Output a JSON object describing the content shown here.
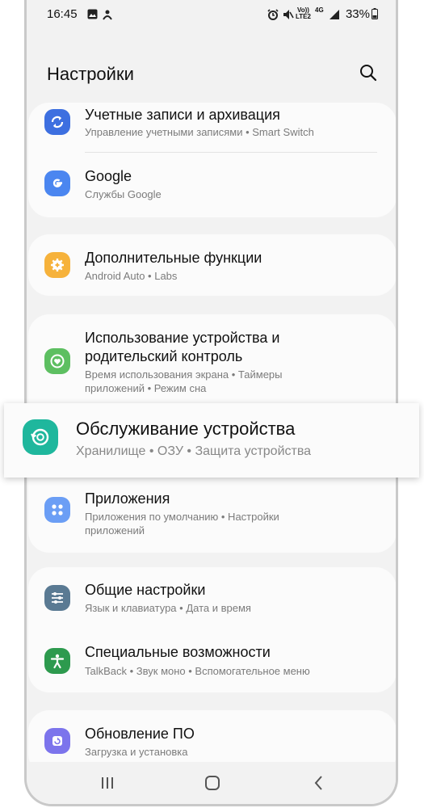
{
  "status": {
    "time": "16:45",
    "vol": "Vo))",
    "lte": "LTE2",
    "net": "4G",
    "battery": "33%"
  },
  "header": {
    "title": "Настройки"
  },
  "items": {
    "accounts": {
      "title": "Учетные записи и архивация",
      "subtitle": "Управление учетными записями • Smart Switch",
      "icon": "sync-icon",
      "color": "#3d6fe0"
    },
    "google": {
      "title": "Google",
      "subtitle": "Службы Google",
      "icon": "google-icon",
      "color": "#4b86f0"
    },
    "advanced": {
      "title": "Дополнительные функции",
      "subtitle": "Android Auto • Labs",
      "icon": "gear-plus-icon",
      "color": "#f6b23b"
    },
    "wellbeing": {
      "title_line1": "Использование устройства и",
      "title_line2": "родительский контроль",
      "subtitle_line1": "Время использования экрана • Таймеры",
      "subtitle_line2": "приложений • Режим сна",
      "icon": "heart-circle-icon",
      "color": "#5dbf61"
    },
    "care": {
      "title": "Обслуживание устройства",
      "subtitle": "Хранилище • ОЗУ • Защита устройства",
      "icon": "device-care-icon",
      "color": "#1fb79d"
    },
    "apps": {
      "title": "Приложения",
      "subtitle_line1": "Приложения по умолчанию • Настройки",
      "subtitle_line2": "приложений",
      "icon": "apps-grid-icon",
      "color": "#6b9ef5"
    },
    "general": {
      "title": "Общие настройки",
      "subtitle": "Язык и клавиатура • Дата и время",
      "icon": "sliders-icon",
      "color": "#5a7a93"
    },
    "accessibility": {
      "title": "Специальные возможности",
      "subtitle": "TalkBack • Звук моно • Вспомогательное меню",
      "icon": "accessibility-icon",
      "color": "#2d9a4e"
    },
    "update": {
      "title": "Обновление ПО",
      "subtitle": "Загрузка и установка",
      "icon": "update-icon",
      "color": "#7c74ec"
    }
  }
}
